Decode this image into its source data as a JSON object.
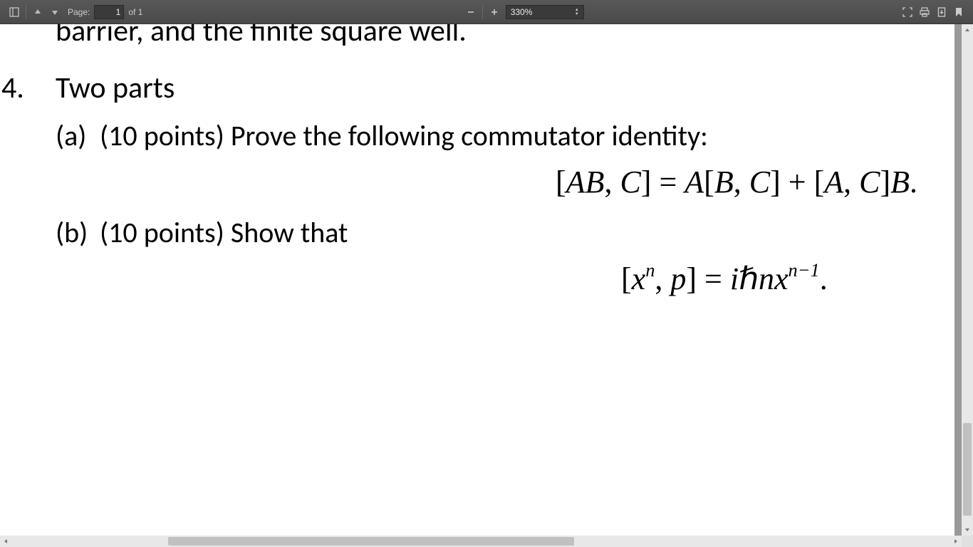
{
  "toolbar": {
    "page_label": "Page:",
    "page_value": "1",
    "page_total_prefix": "of",
    "page_total": "1",
    "zoom_value": "330%"
  },
  "document": {
    "clipped_prev_line": "barrier, and the finite square well.",
    "question_number": "4.",
    "question_title": "Two parts",
    "part_a": {
      "label": "(a)",
      "text": "(10 points) Prove the following commutator identity:"
    },
    "equation_a": {
      "lhs_open": "[",
      "lhs_A": "A",
      "lhs_B": "B",
      "lhs_comma": ", ",
      "lhs_C": "C",
      "lhs_close": "]",
      "eq": " = ",
      "r1_A": "A",
      "r1_open": "[",
      "r1_B": "B",
      "r1_comma": ", ",
      "r1_C": "C",
      "r1_close": "]",
      "plus": " + ",
      "r2_open": "[",
      "r2_A": "A",
      "r2_comma": ", ",
      "r2_C": "C",
      "r2_close": "]",
      "r2_B": "B",
      "period": "."
    },
    "part_b": {
      "label": "(b)",
      "text": "(10 points) Show that"
    },
    "equation_b": {
      "open": "[",
      "x": "x",
      "sup_n": "n",
      "comma": ", ",
      "p": "p",
      "close": "]",
      "eq": " = ",
      "i": "i",
      "hbar": "ℏ",
      "n": "n",
      "x2": "x",
      "sup_nm1": "n−1",
      "period": "."
    }
  }
}
